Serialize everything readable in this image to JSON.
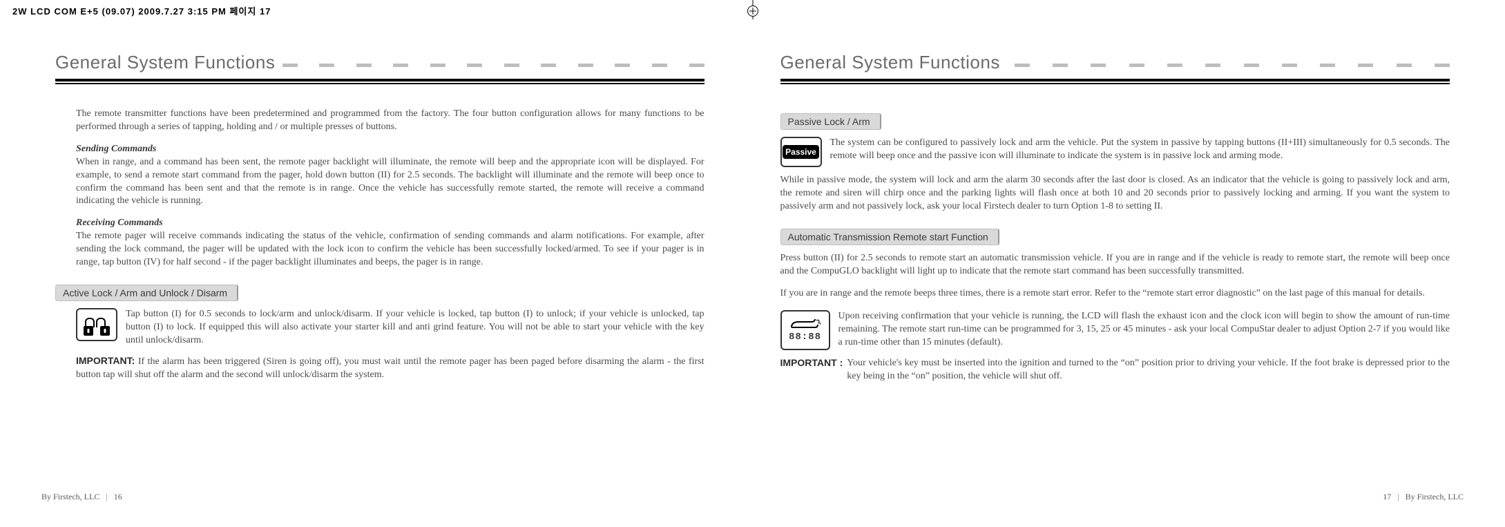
{
  "crop_header": "2W LCD COM E+5 (09.07)  2009.7.27 3:15 PM  페이지 17",
  "left": {
    "title": "General System Functions",
    "intro": "The remote transmitter functions have been predetermined and programmed from the factory. The four button configuration allows for many functions to be performed through a series of tapping, holding and / or multiple presses of buttons.",
    "sending_head": "Sending Commands",
    "sending_body": "When in range, and a command has been sent, the remote pager backlight will illuminate, the remote will beep and the appropriate icon will be displayed. For example, to send a remote start command from the pager, hold down button (II) for 2.5 seconds. The backlight will illuminate and the remote will beep once to confirm the command has been sent and that the remote is in range. Once the vehicle has successfully remote started, the remote will receive a command indicating the vehicle is running.",
    "receiving_head": "Receiving Commands",
    "receiving_body": "The remote pager will receive commands indicating the status of the vehicle, confirmation of sending commands and alarm notifications. For example, after sending the lock command, the pager will be updated with the lock icon to confirm the vehicle has been successfully locked/armed. To see if your pager is in range, tap button (IV) for half second - if the pager backlight illuminates and beeps, the pager is in range.",
    "pill_active": "Active Lock / Arm and Unlock / Disarm",
    "active_body": "Tap button (I) for 0.5 seconds to lock/arm and unlock/disarm. If your vehicle is locked, tap button (I) to unlock; if your vehicle is unlocked, tap button (I) to lock. If equipped this will also activate your starter kill and anti grind feature. You will not be able to start your vehicle with the key until unlock/disarm.",
    "important_label": "IMPORTANT:",
    "important_body": "If the alarm has been triggered (Siren is going off), you must wait until the remote pager has been paged before disarming the alarm - the first button tap will shut off the alarm and the second will unlock/disarm the system.",
    "footer_company": "By Firstech, LLC",
    "footer_page": "16"
  },
  "right": {
    "title": "General System Functions",
    "pill_passive": "Passive Lock / Arm",
    "passive_badge": "Passive",
    "passive_intro": "The system can be configured to passively lock and arm the vehicle. Put the system in passive by tapping buttons (II+III) simultaneously for 0.5 seconds. The remote will beep once and the passive icon will illuminate to indicate the system is in passive lock and arming mode.",
    "passive_body": "While in passive mode, the system will lock and arm the alarm 30 seconds after the last door is closed.  As an indicator that the vehicle is going to passively lock and arm, the remote and siren will chirp once and the parking lights will flash once at both 10 and 20 seconds prior to passively locking and arming. If you want the system to passively arm and not passively lock, ask your local Firstech dealer to turn Option 1-8 to setting II.",
    "pill_auto": "Automatic Transmission Remote start Function",
    "auto_p1": "Press button (II) for 2.5 seconds to remote start an automatic transmission vehicle. If you are in range and if the vehicle is ready to remote start, the remote will beep once and the CompuGLO backlight will light up to indicate that the remote start command has been successfully transmitted.",
    "auto_p2": "If you are in range and the remote beeps three times, there is a remote start error. Refer to the  “remote start error diagnostic” on the last page of this manual for details.",
    "clock_time": "88:88",
    "auto_confirm": "Upon receiving confirmation that your vehicle is running, the LCD will flash the exhaust icon and the clock icon will begin to show the amount of run-time remaining. The remote start run-time can be programmed for 3, 15, 25 or 45 minutes - ask your local CompuStar dealer to adjust Option 2-7 if you would like a run-time other than 15 minutes (default).",
    "important_label": "IMPORTANT :",
    "important_body": "Your vehicle's key must be inserted into the ignition and turned to the “on” position prior to driving your vehicle. If the foot brake is depressed prior to the key being in the “on” position, the vehicle will shut off.",
    "footer_page": "17",
    "footer_company": "By Firstech, LLC"
  }
}
